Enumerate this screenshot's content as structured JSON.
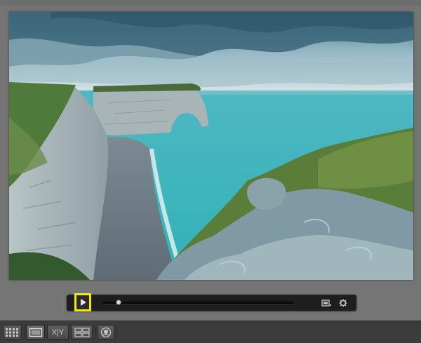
{
  "photo": {
    "subject": "cliffs-arch-sea-image"
  },
  "video_controls": {
    "play_icon": "play-icon",
    "progress": 0.08,
    "frame_icon": "frame-icon",
    "settings_icon": "gear-icon"
  },
  "view_modes": {
    "grid_icon": "grid-view-icon",
    "loupe_icon": "loupe-view-icon",
    "compare_label": "X|Y",
    "survey_icon": "survey-view-icon",
    "people_icon": "people-view-icon"
  },
  "colors": {
    "highlight": "#f2ea00",
    "control_bar": "#1e1e1e",
    "background": "#727272",
    "toolbar": "#3c3c3c"
  }
}
